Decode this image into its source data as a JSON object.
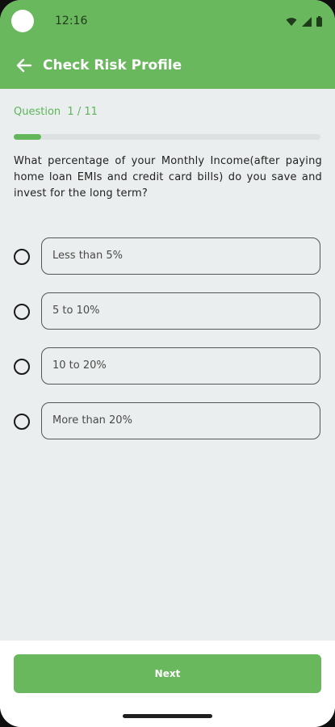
{
  "status_bar": {
    "time": "12:16",
    "icons": [
      "wifi-icon",
      "signal-icon",
      "battery-icon"
    ]
  },
  "app_bar": {
    "title": "Check Risk Profile",
    "back_icon": "arrow-left-icon"
  },
  "quiz": {
    "counter": "Question  1 / 11",
    "progress": 0.09,
    "question": "What percentage of your Monthly Income(after paying home loan EMIs and credit card bills) do you save and invest for the long term?",
    "options": [
      {
        "label": "Less than 5%",
        "selected": false
      },
      {
        "label": "5 to 10%",
        "selected": false
      },
      {
        "label": "10 to 20%",
        "selected": false
      },
      {
        "label": "More than 20%",
        "selected": false
      }
    ]
  },
  "footer": {
    "next_label": "Next"
  },
  "colors": {
    "accent": "#6ab85e",
    "background": "#ebeeee"
  }
}
